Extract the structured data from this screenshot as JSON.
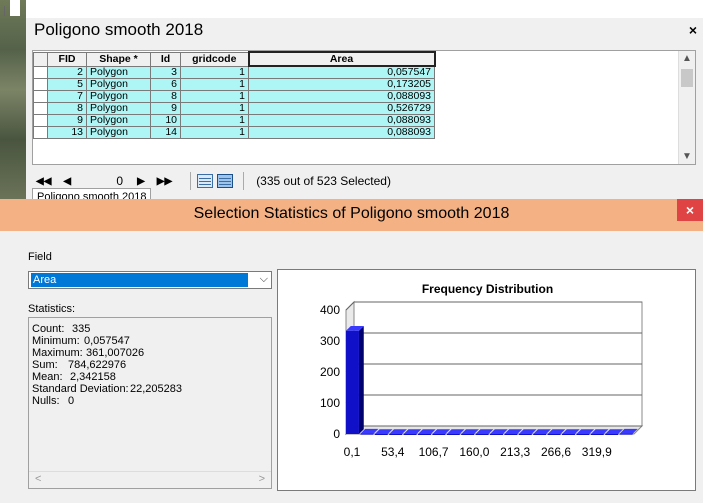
{
  "attribute_table": {
    "title": "Poligono smooth 2018",
    "close_glyph": "×",
    "columns": [
      "FID",
      "Shape *",
      "Id",
      "gridcode",
      "Area"
    ],
    "rows": [
      [
        "2",
        "Polygon",
        "3",
        "1",
        "0,057547"
      ],
      [
        "5",
        "Polygon",
        "6",
        "1",
        "0,173205"
      ],
      [
        "7",
        "Polygon",
        "8",
        "1",
        "0,088093"
      ],
      [
        "8",
        "Polygon",
        "9",
        "1",
        "0,526729"
      ],
      [
        "9",
        "Polygon",
        "10",
        "1",
        "0,088093"
      ],
      [
        "13",
        "Polygon",
        "14",
        "1",
        "0,088093"
      ]
    ],
    "navigation": {
      "first": "◀◀",
      "prev": "◀",
      "record": "0",
      "next": "▶",
      "last": "▶▶",
      "selection_info": "(335 out of 523 Selected)"
    },
    "tab_label": "Poligono smooth 2018"
  },
  "stats_dialog": {
    "title": "Selection Statistics of Poligono smooth 2018",
    "close_glyph": "×",
    "field_label": "Field",
    "field_value": "Area",
    "statistics_label": "Statistics:",
    "statistics": [
      {
        "label": "Count:",
        "value": "335"
      },
      {
        "label": "Minimum:",
        "value": "0,057547"
      },
      {
        "label": "Maximum:",
        "value": "361,007026"
      },
      {
        "label": "Sum:",
        "value": "784,622976"
      },
      {
        "label": "Mean:",
        "value": "2,342158"
      },
      {
        "label": "Standard Deviation:",
        "value": "22,205283"
      },
      {
        "label": "Nulls:",
        "value": "0"
      }
    ],
    "colors": {
      "titlebar": "#f4b183",
      "close": "#e04343",
      "bar": "#1010c8",
      "selection": "#0078d7",
      "row_highlight": "#aef5f5"
    }
  },
  "chart_data": {
    "type": "bar",
    "title": "Frequency Distribution",
    "categories": [
      "0,1",
      "53,4",
      "106,7",
      "160,0",
      "213,3",
      "266,6",
      "319,9"
    ],
    "bins": 20,
    "values": [
      333,
      1,
      0,
      0,
      0,
      0,
      0,
      0,
      0,
      0,
      0,
      0,
      0,
      0,
      0,
      0,
      0,
      0,
      0,
      1
    ],
    "ylim": [
      0,
      400
    ],
    "yticks": [
      "0",
      "100",
      "200",
      "300",
      "400"
    ],
    "grid": true
  }
}
